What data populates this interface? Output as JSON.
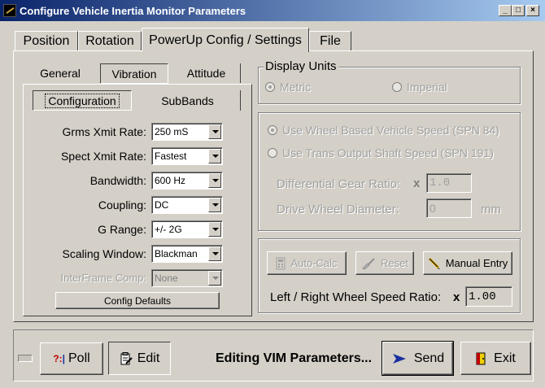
{
  "window": {
    "title": "Configure Vehicle Inertia Monitor Parameters",
    "controls": [
      "_",
      "□",
      "×"
    ]
  },
  "tabs": [
    {
      "label": "Position"
    },
    {
      "label": "Rotation"
    },
    {
      "label": "PowerUp Config / Settings",
      "active": true
    },
    {
      "label": "File"
    }
  ],
  "subtabs": [
    {
      "label": "General"
    },
    {
      "label": "Vibration",
      "active": true
    },
    {
      "label": "Attitude"
    }
  ],
  "subsubtabs": [
    {
      "label": "Configuration",
      "active": true
    },
    {
      "label": "SubBands"
    }
  ],
  "vibration": {
    "fields": [
      {
        "label": "Grms Xmit Rate:",
        "value": "250 mS"
      },
      {
        "label": "Spect Xmit Rate:",
        "value": "Fastest"
      },
      {
        "label": "Bandwidth:",
        "value": "600 Hz"
      },
      {
        "label": "Coupling:",
        "value": "DC"
      },
      {
        "label": "G Range:",
        "value": "+/- 2G"
      },
      {
        "label": "Scaling Window:",
        "value": "Blackman"
      },
      {
        "label": "InterFrame Comp:",
        "value": "None",
        "disabled": true
      }
    ],
    "defaults_button": "Config Defaults"
  },
  "display_units": {
    "title": "Display Units",
    "options": [
      {
        "label": "Metric",
        "selected": true
      },
      {
        "label": "Imperial",
        "selected": false
      }
    ]
  },
  "speed_source": {
    "options": [
      {
        "label": "Use Wheel Based Vehicle Speed (SPN 84)",
        "selected": true
      },
      {
        "label": "Use Trans Output Shaft Speed (SPN 191)",
        "selected": false
      }
    ],
    "gear_ratio_label": "Differential Gear Ratio:",
    "gear_ratio_prefix": "x",
    "gear_ratio_value": "1.0",
    "wheel_diameter_label": "Drive Wheel Diameter:",
    "wheel_diameter_value": "0",
    "wheel_diameter_unit": "mm"
  },
  "wheel_ratio": {
    "auto_calc": "Auto-Calc",
    "reset": "Reset",
    "manual_entry": "Manual Entry",
    "ratio_label": "Left / Right Wheel Speed Ratio:",
    "ratio_prefix": "x",
    "ratio_value": "1.00"
  },
  "footer": {
    "poll": "Poll",
    "edit": "Edit",
    "status": "Editing VIM Parameters...",
    "send": "Send",
    "exit": "Exit",
    "colors": {
      "send_arrow": "#1a2fa0",
      "exit_door": "#f0d000",
      "poll_icon": "#c00000"
    }
  }
}
